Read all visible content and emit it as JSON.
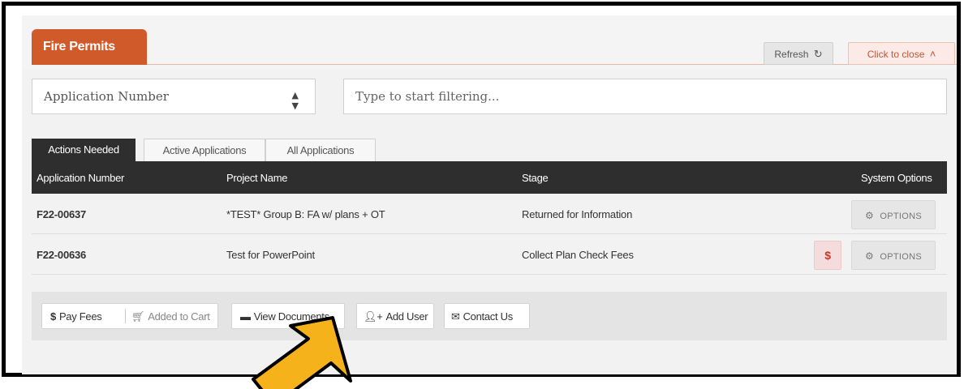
{
  "panel": {
    "title": "Fire Permits",
    "refresh_label": "Refresh",
    "close_label": "Click to close"
  },
  "filter": {
    "select_value": "Application Number",
    "input_placeholder": "Type to start filtering..."
  },
  "tabs": [
    {
      "label": "Actions Needed",
      "active": true
    },
    {
      "label": "Active Applications",
      "active": false
    },
    {
      "label": "All Applications",
      "active": false
    }
  ],
  "table": {
    "columns": [
      "Application Number",
      "Project Name",
      "Stage",
      "System Options"
    ],
    "rows": [
      {
        "number": "F22-00637",
        "project": "*TEST* Group B: FA w/ plans + OT",
        "stage": "Returned for Information",
        "fee_button": "",
        "options_label": "OPTIONS"
      },
      {
        "number": "F22-00636",
        "project": "Test for PowerPoint",
        "stage": "Collect Plan Check Fees",
        "fee_button": "$",
        "options_label": "OPTIONS"
      }
    ]
  },
  "actions": {
    "pay_fees": "Pay Fees",
    "added_to_cart": "Added to Cart",
    "view_documents": "View Documents",
    "add_user": "Add User",
    "contact_us": "Contact Us"
  },
  "colors": {
    "brand": "#d05a2a",
    "header_dark": "#2e2e2e",
    "link": "#9b1b30",
    "arrow": "#f5b21b"
  },
  "icons": {
    "refresh": "refresh-icon",
    "close": "chevron-up-icon",
    "select": "sort-caret-icon",
    "options": "gears-icon",
    "pay": "dollar-icon",
    "cart": "cart-icon",
    "folder": "folder-open-icon",
    "user": "user-plus-icon",
    "envelope": "envelope-icon",
    "pointer": "arrow-pointer-icon"
  }
}
